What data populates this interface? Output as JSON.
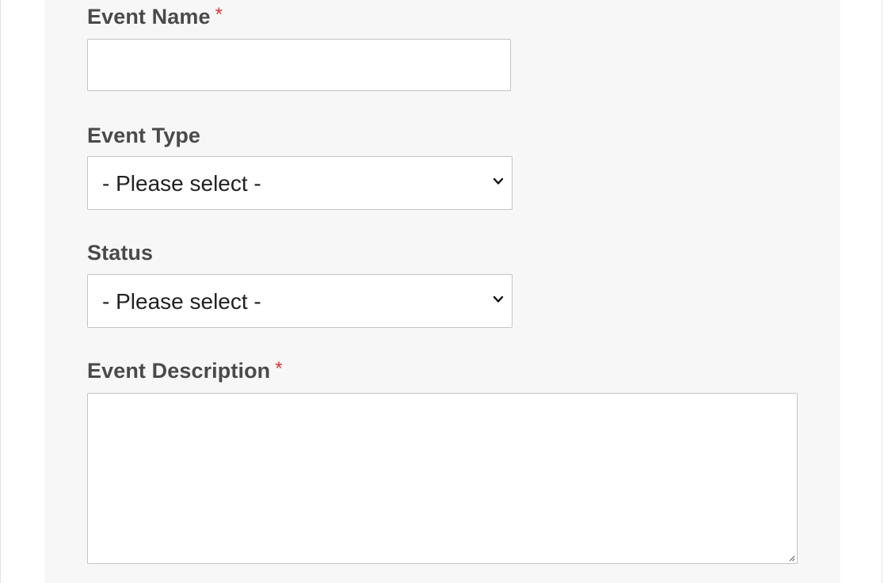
{
  "form": {
    "event_name": {
      "label": "Event Name",
      "required_marker": "*",
      "value": ""
    },
    "event_type": {
      "label": "Event Type",
      "selected": "- Please select -",
      "icon": "chevron-down-icon"
    },
    "status": {
      "label": "Status",
      "selected": "- Please select -",
      "icon": "chevron-down-icon"
    },
    "event_description": {
      "label": "Event Description",
      "required_marker": "*",
      "value": ""
    }
  },
  "colors": {
    "panel_background": "#f7f7f7",
    "label_text": "#4a4a4a",
    "required_marker": "#d63638",
    "field_border": "#c4c4c4",
    "field_background": "#ffffff"
  }
}
